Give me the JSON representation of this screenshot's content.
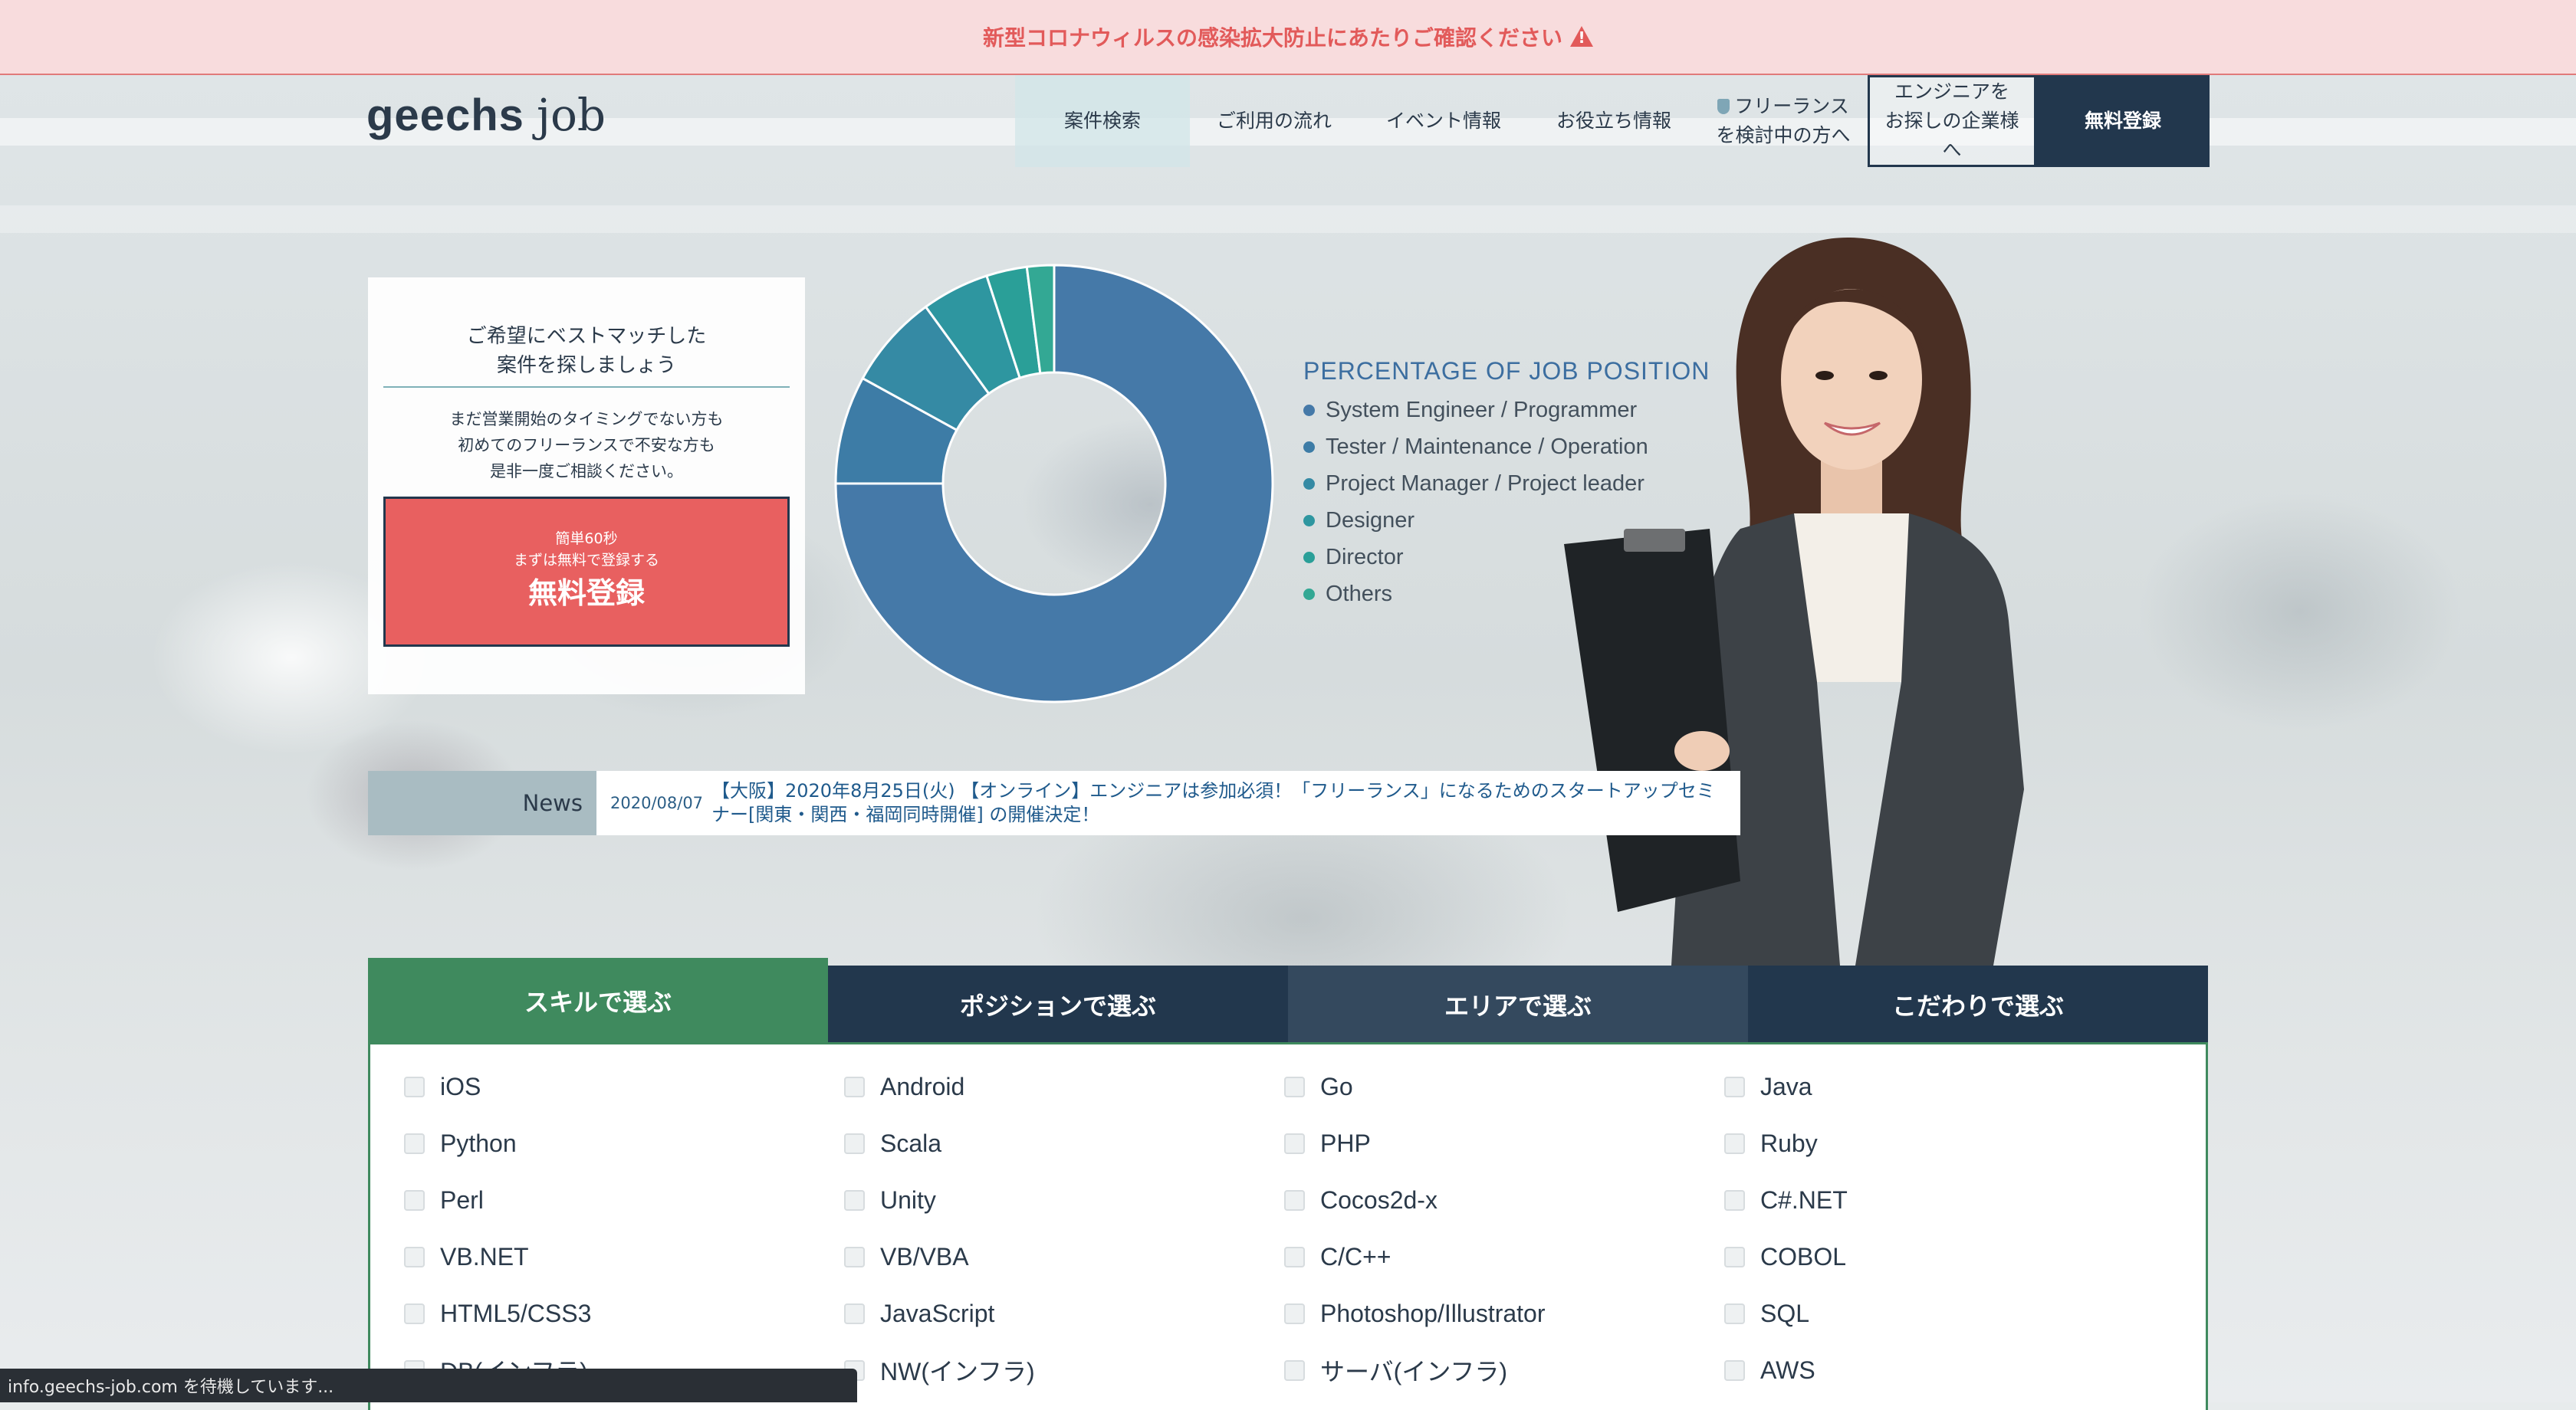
{
  "notice": {
    "text": "新型コロナウィルスの感染拡大防止にあたりご確認ください",
    "icon": "warning-icon"
  },
  "header": {
    "logo_bold": "geechs",
    "logo_light": "job",
    "nav": [
      {
        "label": "案件検索"
      },
      {
        "label": "ご利用の流れ"
      },
      {
        "label": "イベント情報"
      },
      {
        "label": "お役立ち情報"
      },
      {
        "line1": "フリーランス",
        "line2": "を検討中の方へ",
        "icon": "shield-icon"
      },
      {
        "line1": "エンジニアを",
        "line2": "お探しの企業様へ"
      },
      {
        "label": "無料登録"
      }
    ]
  },
  "card": {
    "title_line1": "ご希望にベストマッチした",
    "title_line2": "案件を探しましょう",
    "text_line1": "まだ営業開始のタイミングでない方も",
    "text_line2": "初めてのフリーランスで不安な方も",
    "text_line3": "是非一度ご相談ください。",
    "button_sub1": "簡単60秒",
    "button_sub2": "まずは無料で登録する",
    "button_main": "無料登録"
  },
  "chart_data": {
    "type": "pie",
    "title": "PERCENTAGE OF JOB POSITION",
    "donut": true,
    "categories": [
      "System Engineer / Programmer",
      "Tester / Maintenance / Operation",
      "Project Manager / Project leader",
      "Designer",
      "Director",
      "Others"
    ],
    "values": [
      75,
      8,
      7,
      5,
      3,
      2
    ],
    "colors": [
      "#4579a8",
      "#3d7ca6",
      "#358aa4",
      "#2e96a0",
      "#2a9f98",
      "#33a894"
    ]
  },
  "news": {
    "label": "News",
    "date": "2020/08/07",
    "text": "【大阪】2020年8月25日(火) 【オンライン】エンジニアは参加必須！「フリーランス」になるためのスタートアップセミナー[関東・関西・福岡同時開催] の開催決定！"
  },
  "tabs": [
    "スキルで選ぶ",
    "ポジションで選ぶ",
    "エリアで選ぶ",
    "こだわりで選ぶ"
  ],
  "skills": [
    "iOS",
    "Android",
    "Go",
    "Java",
    "Python",
    "Scala",
    "PHP",
    "Ruby",
    "Perl",
    "Unity",
    "Cocos2d-x",
    "C#.NET",
    "VB.NET",
    "VB/VBA",
    "C/C++",
    "COBOL",
    "HTML5/CSS3",
    "JavaScript",
    "Photoshop/Illustrator",
    "SQL",
    "DB(インフラ)",
    "NW(インフラ)",
    "サーバ(インフラ)",
    "AWS"
  ],
  "status_bar": "info.geechs-job.com を待機しています..."
}
